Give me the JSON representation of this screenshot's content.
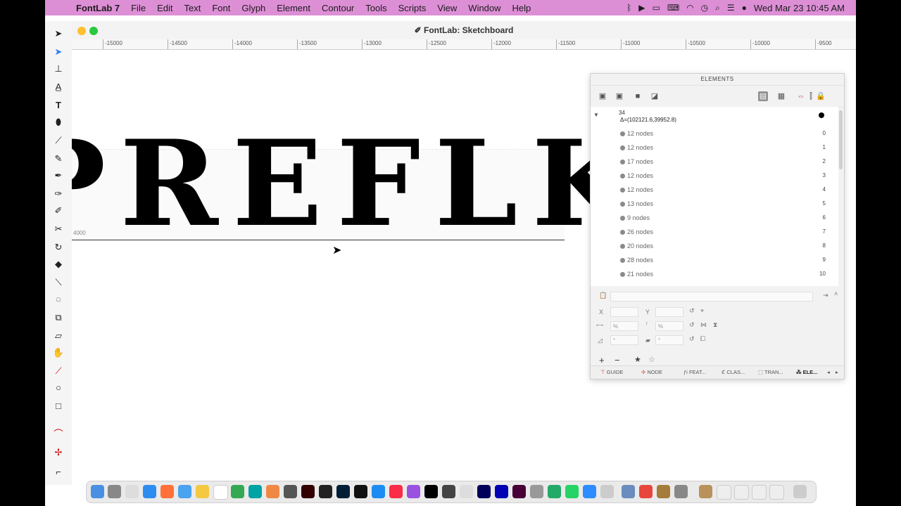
{
  "menubar": {
    "app": "FontLab 7",
    "items": [
      "File",
      "Edit",
      "Text",
      "Font",
      "Glyph",
      "Element",
      "Contour",
      "Tools",
      "Scripts",
      "View",
      "Window",
      "Help"
    ],
    "clock": "Wed Mar 23  10:45 AM"
  },
  "window": {
    "title": "✐ FontLab: Sketchboard"
  },
  "ruler": {
    "ticks": [
      "-15000",
      "-14500",
      "-14000",
      "-13500",
      "-13000",
      "-12500",
      "-12000",
      "-11500",
      "-11000",
      "-10500",
      "-10000",
      "-9500"
    ]
  },
  "canvas": {
    "glyph_text": "PREFLK",
    "coord_label": "4000"
  },
  "panel": {
    "title": "ELEMENTS",
    "group": {
      "count": "34",
      "delta": "Δ=(102121.6,39952.8)"
    },
    "rows": [
      {
        "label": "12 nodes",
        "index": "0"
      },
      {
        "label": "12 nodes",
        "index": "1"
      },
      {
        "label": "17 nodes",
        "index": "2"
      },
      {
        "label": "12 nodes",
        "index": "3"
      },
      {
        "label": "12 nodes",
        "index": "4"
      },
      {
        "label": "13 nodes",
        "index": "5"
      },
      {
        "label": "9 nodes",
        "index": "6"
      },
      {
        "label": "26 nodes",
        "index": "7"
      },
      {
        "label": "20 nodes",
        "index": "8"
      },
      {
        "label": "28 nodes",
        "index": "9"
      },
      {
        "label": "21 nodes",
        "index": "10"
      }
    ],
    "props": {
      "x_label": "X",
      "y_label": "Y",
      "pct1": "%",
      "pct2": "%",
      "deg1": "°",
      "deg2": "°"
    },
    "tabs": [
      "GUIDE",
      "NODE",
      "FEAT...",
      "CLAS...",
      "TRAN...",
      "ELE..."
    ]
  },
  "colors": {
    "menubar": "#dd8fd6",
    "accent": "#2d7cf6"
  }
}
